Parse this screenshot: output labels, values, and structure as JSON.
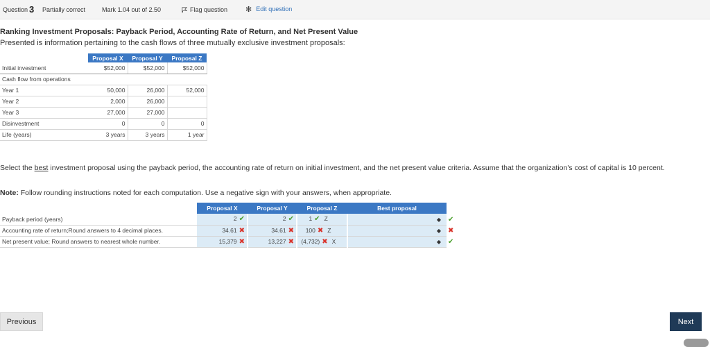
{
  "header": {
    "question_label": "Question",
    "question_number": "3",
    "status": "Partially correct",
    "mark": "Mark 1.04 out of 2.50",
    "flag_label": "Flag question",
    "edit_label": "Edit question"
  },
  "title": "Ranking Investment Proposals: Payback Period, Accounting Rate of Return, and Net Present Value",
  "subtitle": "Presented is information pertaining to the cash flows of three mutually exclusive investment proposals:",
  "info_table": {
    "headers": [
      "Proposal X",
      "Proposal Y",
      "Proposal Z"
    ],
    "rows": [
      {
        "label": "Initial investment",
        "values": [
          "$52,000",
          "$52,000",
          "$52,000"
        ]
      },
      {
        "label": "Cash flow from operations",
        "values": [
          "",
          "",
          ""
        ]
      },
      {
        "label": "Year 1",
        "values": [
          "50,000",
          "26,000",
          "52,000"
        ]
      },
      {
        "label": "Year 2",
        "values": [
          "2,000",
          "26,000",
          ""
        ]
      },
      {
        "label": "Year 3",
        "values": [
          "27,000",
          "27,000",
          ""
        ]
      },
      {
        "label": "Disinvestment",
        "values": [
          "0",
          "0",
          "0"
        ]
      },
      {
        "label": "Life (years)",
        "values": [
          "3 years",
          "3 years",
          "1 year"
        ]
      }
    ]
  },
  "instructions": {
    "pre": "Select the ",
    "emph": "best",
    "post": " investment proposal  using the payback period, the accounting rate of return on initial investment, and the net present value criteria. Assume that the organization's cost of capital is 10 percent."
  },
  "note": {
    "label": "Note:",
    "text": " Follow rounding instructions noted for each computation.  Use a negative sign with your answers, when appropriate."
  },
  "answer_table": {
    "headers": [
      "Proposal X",
      "Proposal Y",
      "Proposal Z",
      "Best proposal"
    ],
    "rows": [
      {
        "label": "Payback period (years)",
        "x": "2",
        "x_mark": "✔",
        "y": "2",
        "y_mark": "✔",
        "z": "1",
        "z_mark": "✔",
        "z_letter": "Z",
        "best_mark": "✔"
      },
      {
        "label": "Accounting rate of return;Round answers to 4 decimal places.",
        "x": "34.61",
        "x_mark": "✖",
        "y": "34.61",
        "y_mark": "✖",
        "z": "100",
        "z_mark": "✖",
        "z_letter": "Z",
        "best_mark": "✖"
      },
      {
        "label": "Net present value; Round answers to nearest whole number.",
        "x": "15,379",
        "x_mark": "✖",
        "y": "13,227",
        "y_mark": "✖",
        "z": "(4,732)",
        "z_mark": "✖",
        "z_letter": "X",
        "best_mark": "✔"
      }
    ]
  },
  "nav": {
    "previous": "Previous",
    "next": "Next"
  },
  "colors": {
    "header_blue": "#3b78c4",
    "answer_cell": "#dcebf6",
    "correct": "#4aa02c",
    "incorrect": "#d9342b",
    "next_button": "#1f3a57"
  }
}
